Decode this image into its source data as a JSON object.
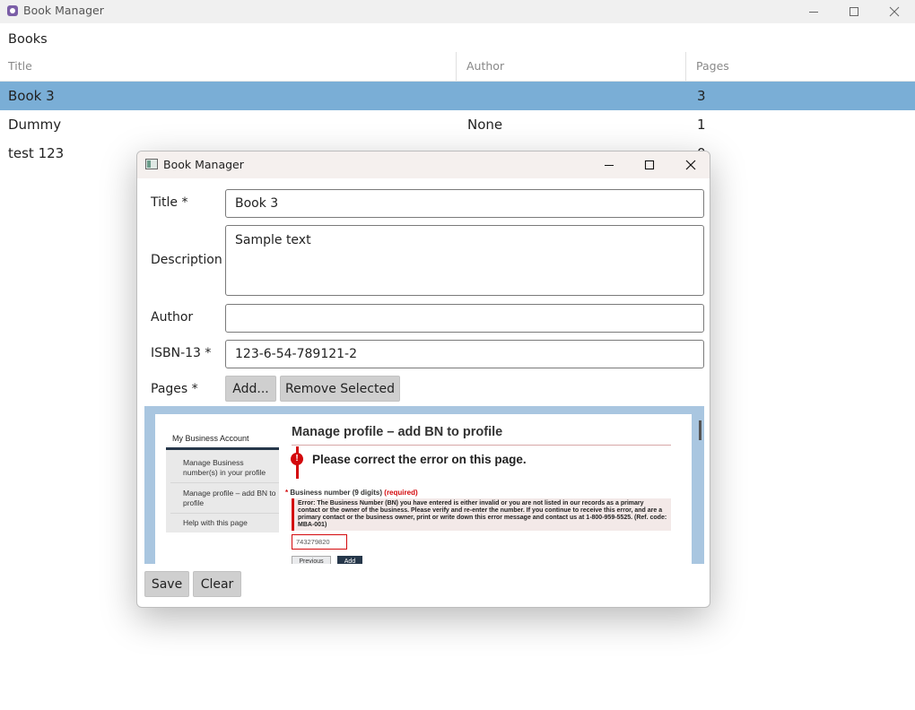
{
  "window": {
    "title": "Book Manager",
    "minimize_icon": "minimize-icon",
    "maximize_icon": "maximize-icon",
    "close_icon": "close-icon"
  },
  "books_section": {
    "label": "Books",
    "columns": [
      "Title",
      "Author",
      "Pages"
    ],
    "rows": [
      {
        "title": "Book 3",
        "author": "",
        "pages": "3",
        "selected": true
      },
      {
        "title": "Dummy",
        "author": "None",
        "pages": "1",
        "selected": false
      },
      {
        "title": "test 123",
        "author": "",
        "pages": "0",
        "selected": false
      }
    ]
  },
  "dialog": {
    "title": "Book Manager",
    "title_label": "Title *",
    "title_value": "Book 3",
    "description_label": "Description",
    "description_value": "Sample text",
    "author_label": "Author",
    "author_value": "",
    "isbn_label": "ISBN-13 *",
    "isbn_value": "123-6-54-789121-2",
    "pages_label": "Pages *",
    "add_button": "Add...",
    "remove_button": "Remove Selected",
    "save_button": "Save",
    "clear_button": "Clear"
  },
  "page_preview": {
    "sidebar_title": "My Business Account",
    "sidebar_items": [
      "Manage Business number(s) in your profile",
      "Manage profile – add BN to profile",
      "Help with this page"
    ],
    "heading": "Manage profile – add BN to profile",
    "error_icon": "!",
    "error_title": "Please correct the error on this page.",
    "field_star": "*",
    "field_label": "Business number (9 digits)",
    "field_required": "(required)",
    "error_message": "Error: The Business Number (BN) you have entered is either invalid or you are not listed in our records as a primary contact or the owner of the business. Please verify and re-enter the number. If you continue to receive this error, and are a primary contact or the business owner, print or write down this error message and contact us at 1-800-959-5525. (Ref. code: MBA-001)",
    "input_value": "743279820",
    "previous_button": "Previous",
    "add_button": "Add"
  },
  "colors": {
    "selected_row": "#7aaed6",
    "preview_background": "#a9c6e0",
    "error_red": "#d3080c",
    "canada_navy": "#26374a"
  }
}
